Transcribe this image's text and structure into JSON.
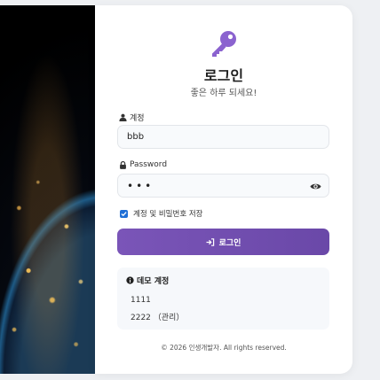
{
  "login": {
    "title": "로그인",
    "subtitle": "좋은 하루 되세요!",
    "account_label": "계정",
    "account_value": "bbb",
    "password_label": "Password",
    "password_value": "•••",
    "remember_label": "계정 및 비밀번호 저장",
    "remember_checked": true,
    "submit_label": "로그인"
  },
  "demo": {
    "title": "데모 계정",
    "accounts": [
      "1111",
      "2222 （관리）"
    ]
  },
  "footer": "© 2026 인생개발자. All rights reserved.",
  "colors": {
    "accent": "#7a55b8",
    "key_icon": "#8b63cf",
    "checkbox": "#1f6fd6"
  },
  "icons": [
    "key-icon",
    "user-icon",
    "lock-icon",
    "eye-icon",
    "login-arrow-icon",
    "info-icon",
    "checkbox-check-icon"
  ]
}
